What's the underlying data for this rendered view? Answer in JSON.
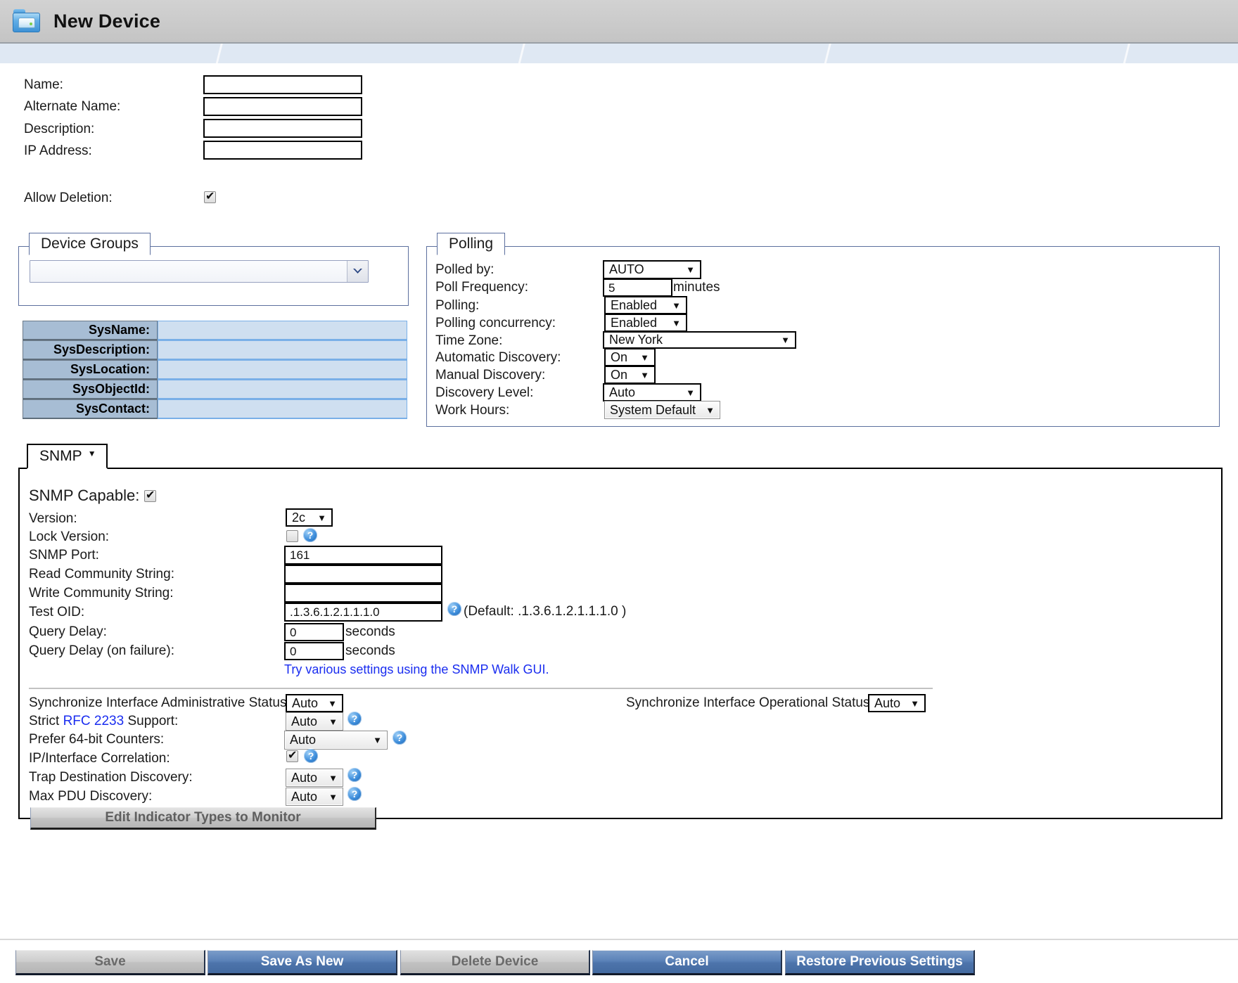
{
  "window": {
    "title": "New Device",
    "icon": "folder-device-icon"
  },
  "identity": {
    "name_label": "Name:",
    "name_value": "",
    "alt_name_label": "Alternate Name:",
    "alt_name_value": "",
    "description_label": "Description:",
    "description_value": "",
    "ip_label": "IP Address:",
    "ip_value": "",
    "allow_deletion_label": "Allow Deletion:",
    "allow_deletion_checked": true
  },
  "device_groups": {
    "legend": "Device Groups",
    "selected": "",
    "dropdown_icon": "chevron-down-icon"
  },
  "sys_table": {
    "rows": [
      {
        "key": "SysName:",
        "value": ""
      },
      {
        "key": "SysDescription:",
        "value": ""
      },
      {
        "key": "SysLocation:",
        "value": ""
      },
      {
        "key": "SysObjectId:",
        "value": ""
      },
      {
        "key": "SysContact:",
        "value": ""
      }
    ]
  },
  "polling": {
    "legend": "Polling",
    "polled_by_label": "Polled by:",
    "polled_by_value": "AUTO",
    "poll_frequency_label": "Poll Frequency:",
    "poll_frequency_value": "5",
    "poll_frequency_units": "minutes",
    "polling_label": "Polling:",
    "polling_value": "Enabled",
    "polling_concurrency_label": "Polling concurrency:",
    "polling_concurrency_value": "Enabled",
    "time_zone_label": "Time Zone:",
    "time_zone_value": "New York",
    "automatic_discovery_label": "Automatic Discovery:",
    "automatic_discovery_value": "On",
    "manual_discovery_label": "Manual Discovery:",
    "manual_discovery_value": "On",
    "discovery_level_label": "Discovery Level:",
    "discovery_level_value": "Auto",
    "work_hours_label": "Work Hours:",
    "work_hours_value": "System Default"
  },
  "snmp": {
    "tab_label": "SNMP",
    "tab_caret": "▼",
    "capable_label": "SNMP Capable:",
    "capable_checked": true,
    "version_label": "Version:",
    "version_value": "2c",
    "lock_version_label": "Lock Version:",
    "lock_version_checked": false,
    "port_label": "SNMP Port:",
    "port_value": "161",
    "read_community_label": "Read Community String:",
    "read_community_value": "",
    "write_community_label": "Write Community String:",
    "write_community_value": "",
    "test_oid_label": "Test OID:",
    "test_oid_value": ".1.3.6.1.2.1.1.1.0",
    "test_oid_default_note": "(Default: .1.3.6.1.2.1.1.1.0 )",
    "query_delay_label": "Query Delay:",
    "query_delay_value": "0",
    "query_delay_units": "seconds",
    "query_delay_fail_label": "Query Delay (on failure):",
    "query_delay_fail_value": "0",
    "query_delay_fail_units": "seconds",
    "walk_link_text": "Try various settings using the SNMP Walk GUI."
  },
  "interface": {
    "sync_admin_label": "Synchronize Interface Administrative Status:",
    "sync_admin_value": "Auto",
    "sync_oper_label": "Synchronize Interface Operational Status:",
    "sync_oper_value": "Auto",
    "strict_rfc_prefix": "Strict ",
    "strict_rfc_link": "RFC 2233",
    "strict_rfc_suffix": " Support:",
    "strict_rfc_value": "Auto",
    "prefer64_label": "Prefer 64-bit Counters:",
    "prefer64_value": "Auto",
    "ip_correlation_label": "IP/Interface Correlation:",
    "ip_correlation_checked": true,
    "trap_dest_label": "Trap Destination Discovery:",
    "trap_dest_value": "Auto",
    "max_pdu_label": "Max PDU Discovery:",
    "max_pdu_value": "Auto",
    "edit_indicator_button": "Edit Indicator Types to Monitor",
    "help_icon": "help-icon"
  },
  "footer": {
    "buttons": [
      {
        "label": "Save",
        "style": "grey"
      },
      {
        "label": "Save As New",
        "style": "blue"
      },
      {
        "label": "Delete Device",
        "style": "grey"
      },
      {
        "label": "Cancel",
        "style": "blue"
      },
      {
        "label": "Restore Previous Settings",
        "style": "blue"
      }
    ]
  },
  "colors": {
    "accent_blue": "#4d74ab",
    "link_blue": "#1a2df0",
    "panel_border": "#5c6f9e",
    "table_key_bg": "#a7bdd4",
    "table_val_bg": "#cfdff0",
    "titlebar_bg": "#cacaca"
  }
}
